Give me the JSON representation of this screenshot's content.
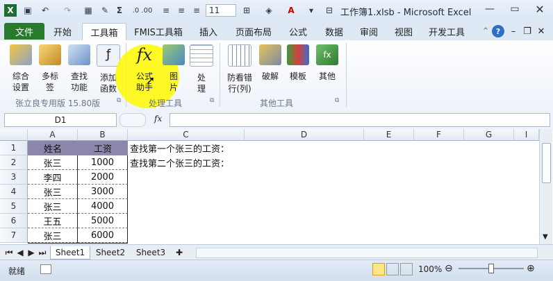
{
  "titlebar": {
    "title": "工作簿1.xlsb  -  Microsoft Excel",
    "font_size_value": "11",
    "quick_access": [
      "excel-logo-icon",
      "save-icon",
      "undo-icon",
      "redo-icon",
      "calendar-icon",
      "format-painter-icon",
      "sigma-icon",
      "decimal-icon",
      "align-left-icon",
      "align-center-icon",
      "align-right-icon",
      "borders-icon",
      "fill-color-icon",
      "font-color-icon",
      "customize-icon"
    ],
    "controls": [
      "minimize",
      "maximize",
      "close"
    ]
  },
  "tabs": [
    "文件",
    "开始",
    "工具箱",
    "FMIS工具箱",
    "插入",
    "页面布局",
    "公式",
    "数据",
    "审阅",
    "视图",
    "开发工具"
  ],
  "active_tab": "工具箱",
  "ribbon": {
    "group1": {
      "label": "张立良专用版 15.80版",
      "buttons": [
        {
          "line1": "综合",
          "line2": "设置"
        },
        {
          "line1": "多标",
          "line2": "签"
        },
        {
          "line1": "查找",
          "line2": "功能"
        },
        {
          "line1": "添加",
          "line2": "函数"
        }
      ]
    },
    "group2": {
      "label": "处理工具",
      "buttons": [
        {
          "line1": "公式",
          "line2": "助手"
        },
        {
          "line1": "图",
          "line2": "片"
        },
        {
          "line1": "处",
          "line2": "理"
        }
      ]
    },
    "group3": {
      "label": "其他工具",
      "buttons": [
        {
          "line1": "防看错",
          "line2": "行(列)"
        },
        {
          "line1": "",
          "line2": "破解"
        },
        {
          "line1": "",
          "line2": "模板"
        },
        {
          "line1": "",
          "line2": "其他"
        }
      ]
    }
  },
  "formula_bar": {
    "name_box": "D1",
    "fx": "fx",
    "formula": ""
  },
  "columns": [
    "A",
    "B",
    "C",
    "D",
    "E",
    "F",
    "G",
    "I"
  ],
  "rows": [
    "1",
    "2",
    "3",
    "4",
    "5",
    "6",
    "7"
  ],
  "table": {
    "headers": [
      "姓名",
      "工资"
    ],
    "rows": [
      [
        "张三",
        "1000"
      ],
      [
        "李四",
        "2000"
      ],
      [
        "张三",
        "3000"
      ],
      [
        "张三",
        "4000"
      ],
      [
        "王五",
        "5000"
      ],
      [
        "张三",
        "6000"
      ]
    ]
  },
  "notes": [
    "查找第一个张三的工资：",
    "查找第二个张三的工资："
  ],
  "sheets": [
    "Sheet1",
    "Sheet2",
    "Sheet3"
  ],
  "active_sheet": "Sheet1",
  "status": {
    "ready": "就绪",
    "zoom": "100%"
  },
  "colors": {
    "header_fill": "#8b86aa",
    "file_tab": "#2a7a2e",
    "highlight": "#fff800"
  }
}
